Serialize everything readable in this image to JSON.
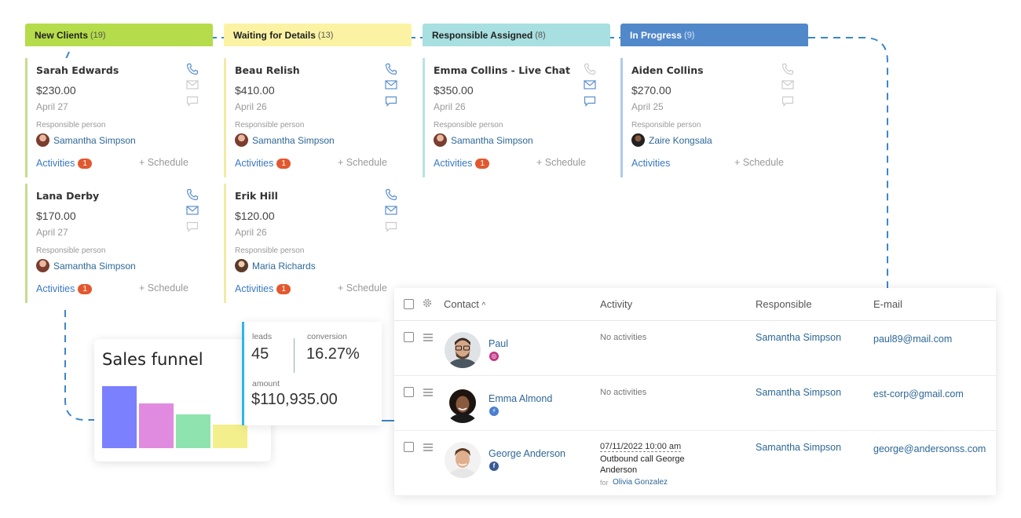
{
  "columns": [
    {
      "title": "New Clients",
      "count": "(19)",
      "color": "#b5dc4a"
    },
    {
      "title": "Waiting for Details",
      "count": "(13)",
      "color": "#fbf3a3"
    },
    {
      "title": "Responsible Assigned",
      "count": "(8)",
      "color": "#a8dfe0"
    },
    {
      "title": "In Progress",
      "count": "(9)",
      "color": "#5188c9"
    }
  ],
  "cards": [
    {
      "name": "Sarah Edwards",
      "amount": "$230.00",
      "date": "April 27",
      "resp_label": "Responsible person",
      "responsible": "Samantha Simpson",
      "activities": "Activities",
      "badge": "1",
      "schedule": "+ Schedule"
    },
    {
      "name": "Lana Derby",
      "amount": "$170.00",
      "date": "April 27",
      "resp_label": "Responsible person",
      "responsible": "Samantha Simpson",
      "activities": "Activities",
      "badge": "1",
      "schedule": "+ Schedule"
    },
    {
      "name": "Beau Relish",
      "amount": "$410.00",
      "date": "April 26",
      "resp_label": "Responsible person",
      "responsible": "Samantha Simpson",
      "activities": "Activities",
      "badge": "1",
      "schedule": "+ Schedule"
    },
    {
      "name": "Erik Hill",
      "amount": "$120.00",
      "date": "April 26",
      "resp_label": "Responsible person",
      "responsible": "Maria Richards",
      "activities": "Activities",
      "badge": "1",
      "schedule": "+ Schedule"
    },
    {
      "name": "Emma Collins - Live Chat",
      "amount": "$350.00",
      "date": "April 26",
      "resp_label": "Responsible person",
      "responsible": "Samantha Simpson",
      "activities": "Activities",
      "badge": "1",
      "schedule": "+ Schedule"
    },
    {
      "name": "Aiden Collins",
      "amount": "$270.00",
      "date": "April 25",
      "resp_label": "Responsible person",
      "responsible": "Zaire Kongsala",
      "activities": "Activities",
      "badge": "",
      "schedule": "+ Schedule"
    }
  ],
  "funnel": {
    "title": "Sales funnel",
    "bars": [
      {
        "value": 1.0,
        "color": "#7b80ff"
      },
      {
        "value": 0.72,
        "color": "#e08be0"
      },
      {
        "value": 0.54,
        "color": "#8ee3ae"
      },
      {
        "value": 0.38,
        "color": "#f3ef8c"
      }
    ]
  },
  "stats": {
    "leads_label": "leads",
    "leads_value": "45",
    "conversion_label": "conversion",
    "conversion_value": "16.27%",
    "amount_label": "amount",
    "amount_value": "$110,935.00"
  },
  "table": {
    "headers": {
      "contact": "Contact",
      "sort_indicator": "^",
      "activity": "Activity",
      "responsible": "Responsible",
      "email": "E-mail"
    },
    "rows": [
      {
        "name": "Paul",
        "social": "instagram",
        "social_color": "#c13584",
        "activity": "No activities",
        "responsible": "Samantha Simpson",
        "email": "paul89@mail.com"
      },
      {
        "name": "Emma Almond",
        "social": "messenger",
        "social_color": "#4a7fd0",
        "activity": "No activities",
        "responsible": "Samantha Simpson",
        "email": "est-corp@gmail.com"
      },
      {
        "name": "George Anderson",
        "social": "facebook",
        "social_color": "#3b5998",
        "activity_date": "07/11/2022 10:00 am",
        "activity_line1": "Outbound call George",
        "activity_line2": "Anderson",
        "activity_for": "for",
        "activity_person": "Olivia Gonzalez",
        "responsible": "Samantha Simpson",
        "email": "george@andersonss.com"
      }
    ]
  }
}
